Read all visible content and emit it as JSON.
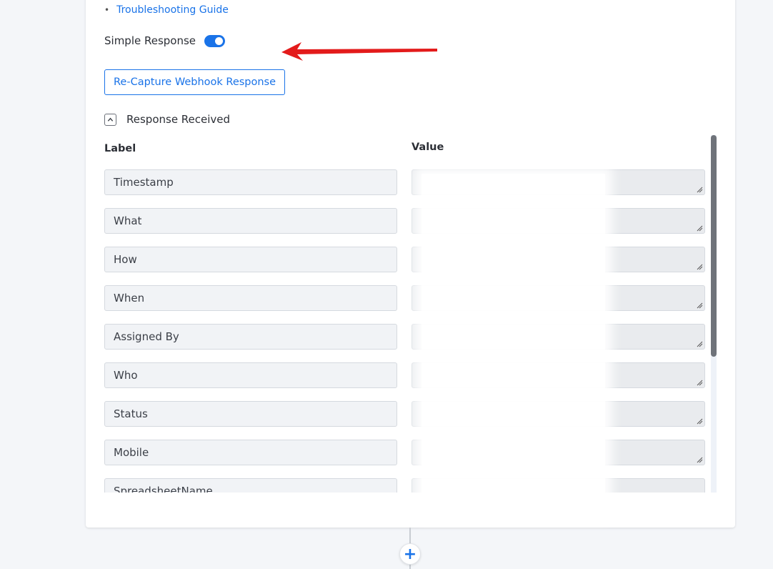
{
  "guide": {
    "link": "Troubleshooting Guide"
  },
  "simple_response": {
    "label": "Simple Response",
    "enabled": true
  },
  "recapture_button": "Re-Capture Webhook Response",
  "response_section": {
    "title": "Response Received",
    "expanded": true
  },
  "columns": {
    "label": "Label",
    "value": "Value"
  },
  "rows": [
    {
      "label": "Timestamp"
    },
    {
      "label": "What"
    },
    {
      "label": "How"
    },
    {
      "label": "When"
    },
    {
      "label": "Assigned By"
    },
    {
      "label": "Who"
    },
    {
      "label": "Status"
    },
    {
      "label": "Mobile"
    },
    {
      "label": "SpreadsheetName"
    }
  ],
  "colors": {
    "accent": "#1a73e8",
    "arrow": "#e31b1b",
    "field_bg": "#f1f3f6",
    "value_bg": "#e9ebee"
  }
}
